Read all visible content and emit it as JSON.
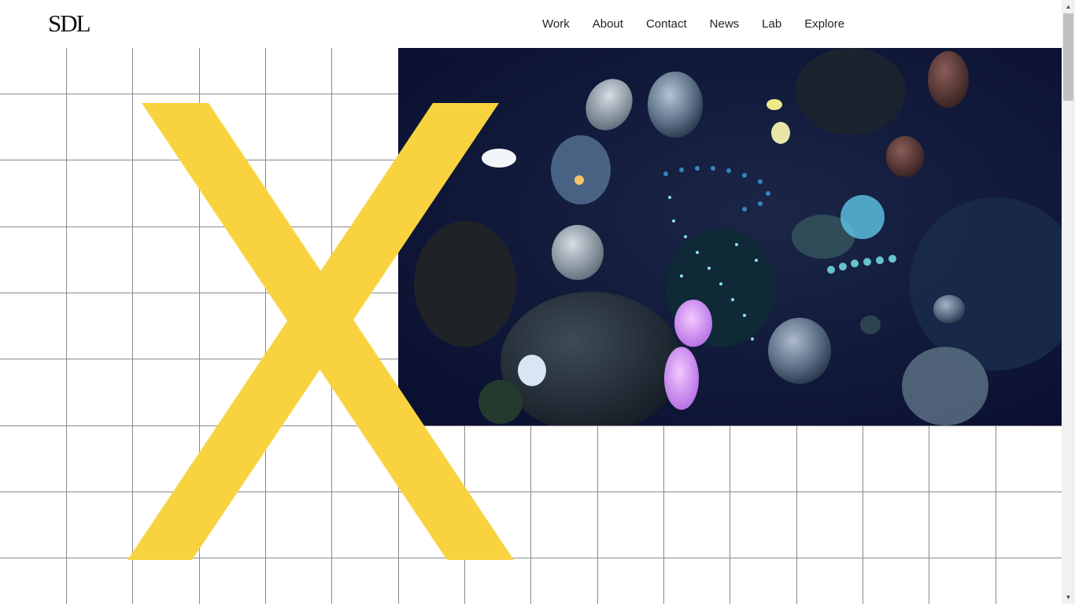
{
  "header": {
    "logo": "SDL",
    "nav": [
      {
        "label": "Work"
      },
      {
        "label": "About"
      },
      {
        "label": "Contact"
      },
      {
        "label": "News"
      },
      {
        "label": "Lab"
      },
      {
        "label": "Explore"
      }
    ]
  },
  "colors": {
    "accent_yellow": "#f9d33f",
    "grid_line": "#8a8a8a",
    "hero_background": "#0d1533"
  },
  "icons": {
    "scroll_up": "triangle-up",
    "scroll_down": "triangle-down"
  }
}
